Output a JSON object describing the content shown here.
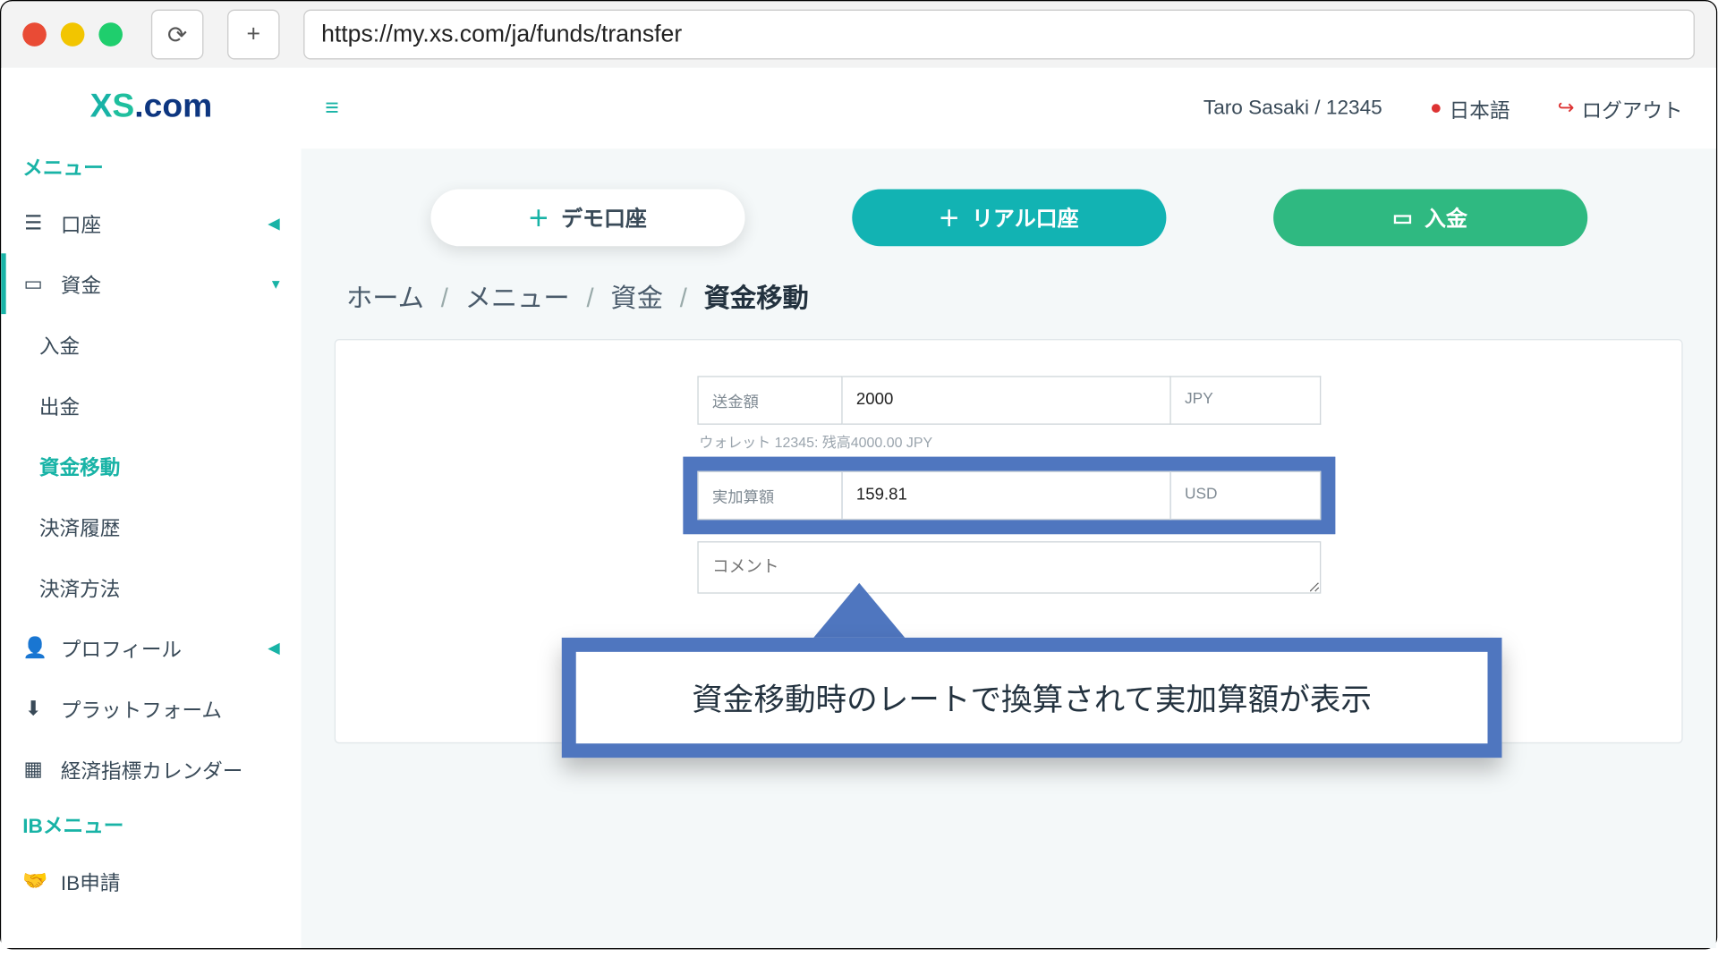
{
  "browser": {
    "url": "https://my.xs.com/ja/funds/transfer"
  },
  "logo": {
    "x": "X",
    "s": "S",
    "dotcom": ".com"
  },
  "sidebar": {
    "menu_head": "メニュー",
    "account": "口座",
    "funds": "資金",
    "sub": {
      "deposit": "入金",
      "withdraw": "出金",
      "transfer": "資金移動",
      "history": "決済履歴",
      "methods": "決済方法"
    },
    "profile": "プロフィール",
    "platform": "プラットフォーム",
    "calendar": "経済指標カレンダー",
    "ib_head": "IBメニュー",
    "ib_apply": "IB申請"
  },
  "topbar": {
    "user": "Taro Sasaki / 12345",
    "lang": "日本語",
    "logout": "ログアウト"
  },
  "pills": {
    "demo": "デモ口座",
    "real": "リアル口座",
    "deposit": "入金"
  },
  "crumbs": {
    "home": "ホーム",
    "menu": "メニュー",
    "funds": "資金",
    "transfer": "資金移動"
  },
  "form": {
    "send_label": "送金額",
    "send_value": "2000",
    "send_currency": "JPY",
    "balance": "ウォレット 12345: 残高4000.00 JPY",
    "actual_label": "実加算額",
    "actual_value": "159.81",
    "actual_currency": "USD",
    "comment_placeholder": "コメント"
  },
  "callout": "資金移動時のレートで換算されて実加算額が表示"
}
